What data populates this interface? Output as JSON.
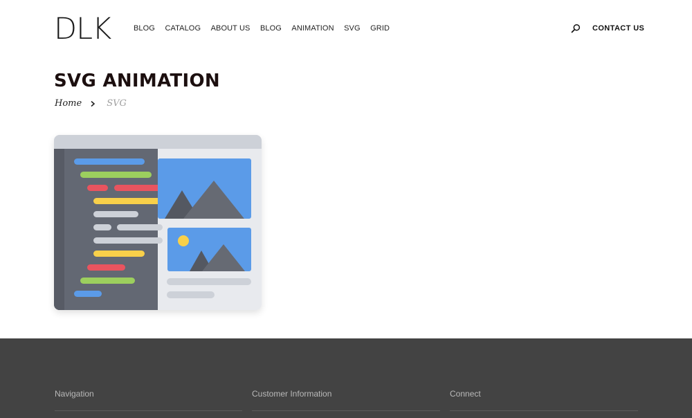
{
  "header": {
    "logo": "DLK",
    "nav": [
      "BLOG",
      "CATALOG",
      "ABOUT US",
      "BLOG",
      "ANIMATION",
      "SVG",
      "GRID"
    ],
    "contact_label": "CONTACT US"
  },
  "page": {
    "title": "SVG ANIMATION",
    "breadcrumb": {
      "home": "Home",
      "current": "SVG"
    }
  },
  "footer": {
    "columns": [
      "Navigation",
      "Customer Information",
      "Connect"
    ]
  },
  "colors": {
    "footer_bg": "#434343",
    "title": "#1c0f0f",
    "code_panel": "#636873",
    "image_blue": "#5b9be8",
    "mountain": "#666a73",
    "sun": "#f8d04a"
  }
}
